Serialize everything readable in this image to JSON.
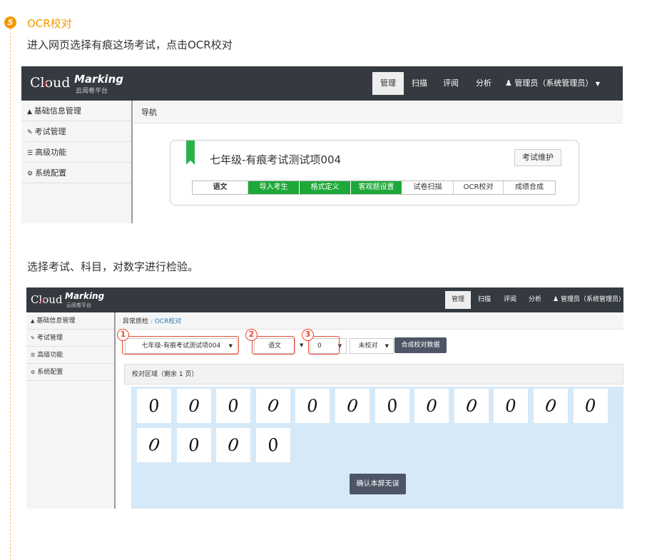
{
  "step": {
    "number": "5",
    "title": "OCR校对"
  },
  "instructions": {
    "first": "进入网页选择有痕这场考试，点击OCR校对",
    "second": "选择考试、科目，对数字进行检验。"
  },
  "app": {
    "logo_cloud": "Cloud",
    "logo_marking": "Marking",
    "logo_sub": "云阅卷平台",
    "nav": [
      "管理",
      "扫描",
      "评阅",
      "分析"
    ],
    "user": "管理员（系统管理员）",
    "user_full": "管理员（系统管理员)",
    "sidebar": [
      "基础信息管理",
      "考试管理",
      "高级功能",
      "系统配置"
    ],
    "sidebar_icons": [
      "sitemap-icon",
      "edit-icon",
      "list-icon",
      "gears-icon"
    ]
  },
  "screen1": {
    "breadcrumb": "导航",
    "exam_title": "七年级-有痕考试测试项004",
    "maintain_button": "考试维护",
    "tabs": [
      {
        "label": "语文",
        "state": "subject"
      },
      {
        "label": "导入考生",
        "state": "done"
      },
      {
        "label": "格式定义",
        "state": "done"
      },
      {
        "label": "客观题设置",
        "state": "done"
      },
      {
        "label": "试卷扫描",
        "state": "todo"
      },
      {
        "label": "OCR校对",
        "state": "todo"
      },
      {
        "label": "成绩合成",
        "state": "todo"
      }
    ],
    "done_color": "#1fa83a"
  },
  "screen2": {
    "breadcrumb_parent": "异常质检",
    "breadcrumb_sep": "/",
    "breadcrumb_current": "OCR校对",
    "exam_select": "七年级-有痕考试测试项004",
    "subject_select": "语文",
    "digit_select": "0",
    "status_select": "未校对",
    "merge_button": "合成校对数据",
    "callouts": [
      "1",
      "2",
      "3"
    ],
    "panel_title": "校对区域（剩余 1 页）",
    "digits_row1": [
      "0",
      "0",
      "0",
      "0",
      "0",
      "0",
      "0",
      "0",
      "0",
      "0",
      "0",
      "0"
    ],
    "digits_row2": [
      "0",
      "0",
      "0",
      "0"
    ],
    "confirm_button": "确认本屏无误",
    "highlight_color": "#e8462f"
  }
}
